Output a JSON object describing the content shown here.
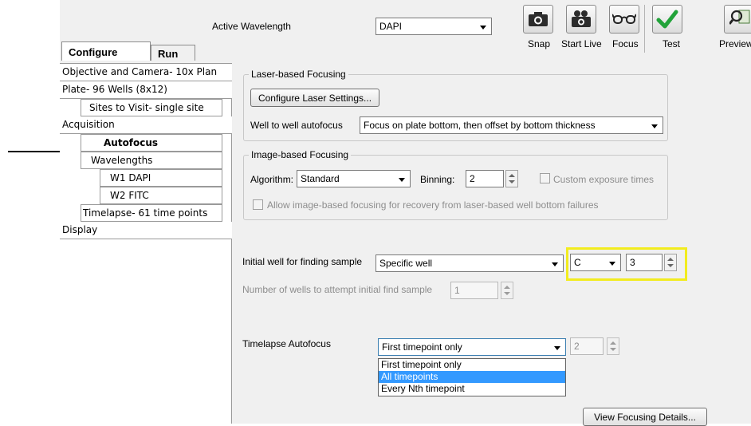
{
  "toolbar": {
    "active_wavelength_label": "Active Wavelength",
    "active_wavelength_value": "DAPI",
    "buttons": [
      {
        "label": "Snap",
        "icon": "camera-icon"
      },
      {
        "label": "Start Live",
        "icon": "video-camera-icon"
      },
      {
        "label": "Focus",
        "icon": "eyeglasses-icon"
      },
      {
        "label": "Test",
        "icon": "checkmark-icon"
      },
      {
        "label": "Preview",
        "icon": "preview-icon"
      }
    ]
  },
  "tabs": [
    "Configure",
    "Run"
  ],
  "sidebar": {
    "items": [
      {
        "label": "Objective and Camera- 10x Plan"
      },
      {
        "label": "Plate- 96 Wells (8x12)"
      },
      {
        "label": "Sites to Visit- single site"
      },
      {
        "label": "Acquisition"
      },
      {
        "label": "Autofocus",
        "selected": true
      },
      {
        "label": "Wavelengths"
      },
      {
        "label": "W1 DAPI"
      },
      {
        "label": "W2 FITC"
      },
      {
        "label": "Timelapse- 61 time points"
      },
      {
        "label": "Display"
      }
    ]
  },
  "laser": {
    "legend": "Laser-based Focusing",
    "configure_button": "Configure Laser Settings...",
    "well_to_well_label": "Well to well autofocus",
    "well_to_well_value": "Focus on plate bottom, then offset by bottom thickness"
  },
  "image": {
    "legend": "Image-based Focusing",
    "algorithm_label": "Algorithm:",
    "algorithm_value": "Standard",
    "binning_label": "Binning:",
    "binning_value": "2",
    "custom_exposure_label": "Custom exposure times",
    "allow_recovery_label": "Allow image-based focusing for recovery from laser-based well bottom failures"
  },
  "initial": {
    "label": "Initial well for finding sample",
    "mode_value": "Specific well",
    "row_value": "C",
    "column_value": "3",
    "attempts_label": "Number of wells to attempt initial find sample",
    "attempts_value": "1"
  },
  "timelapse": {
    "label": "Timelapse Autofocus",
    "value": "First timepoint only",
    "nth_value": "2",
    "options": [
      "First timepoint only",
      "All timepoints",
      "Every Nth timepoint"
    ],
    "highlighted_option": "All timepoints"
  },
  "view_details_button": "View Focusing Details...",
  "colors": {
    "highlight_box": "#f2ec1f",
    "selection": "#3399ff",
    "test_icon_green": "#22a33a"
  }
}
